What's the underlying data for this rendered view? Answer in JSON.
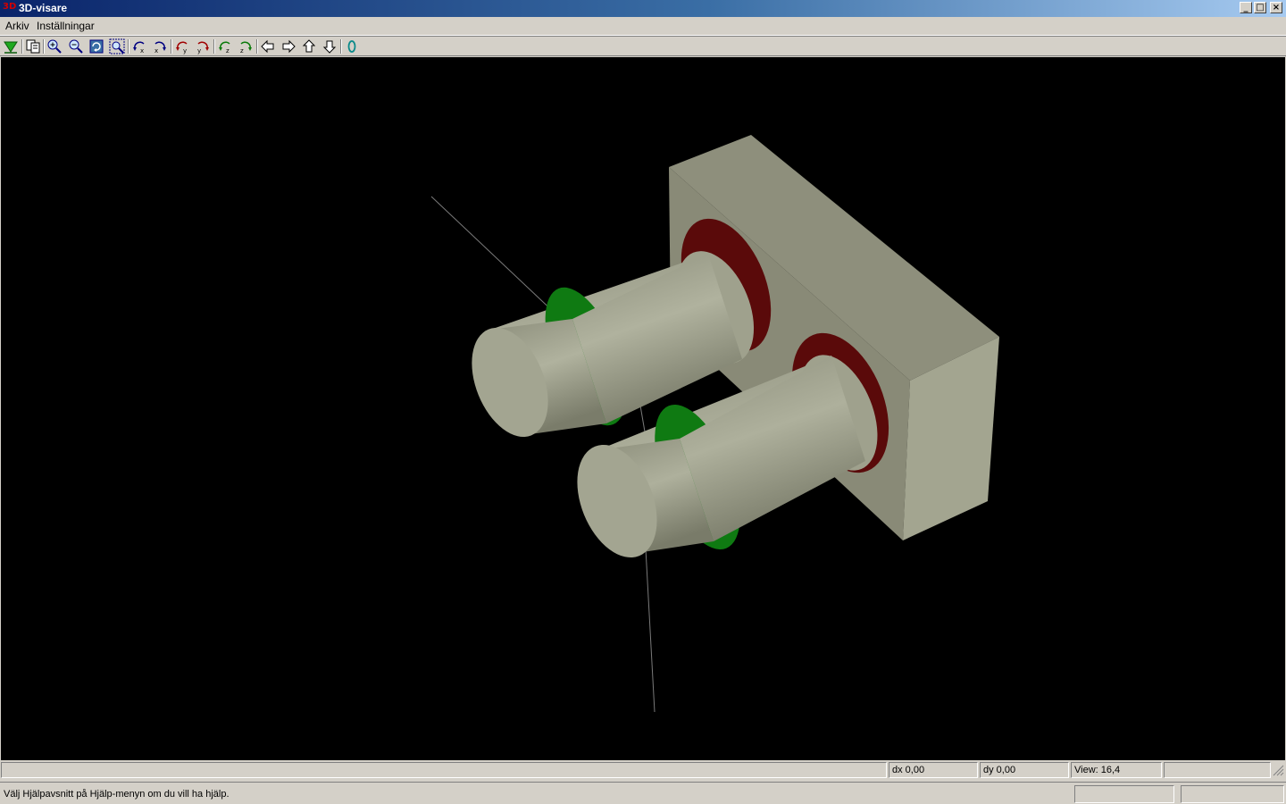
{
  "window": {
    "title": "3D-visare",
    "icon_text": "3D"
  },
  "window_controls": {
    "minimize": "_",
    "maximize": "□",
    "close": "×"
  },
  "menu": [
    {
      "label": "Arkiv"
    },
    {
      "label": "Inställningar"
    }
  ],
  "toolbar": {
    "buttons": [
      "export-down-icon",
      "copy-icon",
      "zoom-in-icon",
      "zoom-out-icon",
      "refresh-icon",
      "zoom-fit-icon",
      "rotate-x-left-icon",
      "rotate-x-right-icon",
      "rotate-y-left-icon",
      "rotate-y-right-icon",
      "rotate-z-left-icon",
      "rotate-z-right-icon",
      "pan-left-icon",
      "pan-right-icon",
      "pan-up-icon",
      "pan-down-icon",
      "reset-view-icon"
    ]
  },
  "status": {
    "main": "",
    "dx": "dx 0,00",
    "dy": "dy 0,00",
    "view": "View: 16,4",
    "extra": "",
    "help": "Välj Hjälpavsnitt på Hjälp-menyn om du vill ha hjälp.",
    "pane2": "",
    "pane3": ""
  },
  "colors": {
    "viewport_bg": "#000000",
    "plate": "#8c8d7a",
    "cylinder": "#a9ab97",
    "ring_green": "#0f7a12",
    "ring_red": "#5c0a0a",
    "axis": "#808080"
  }
}
